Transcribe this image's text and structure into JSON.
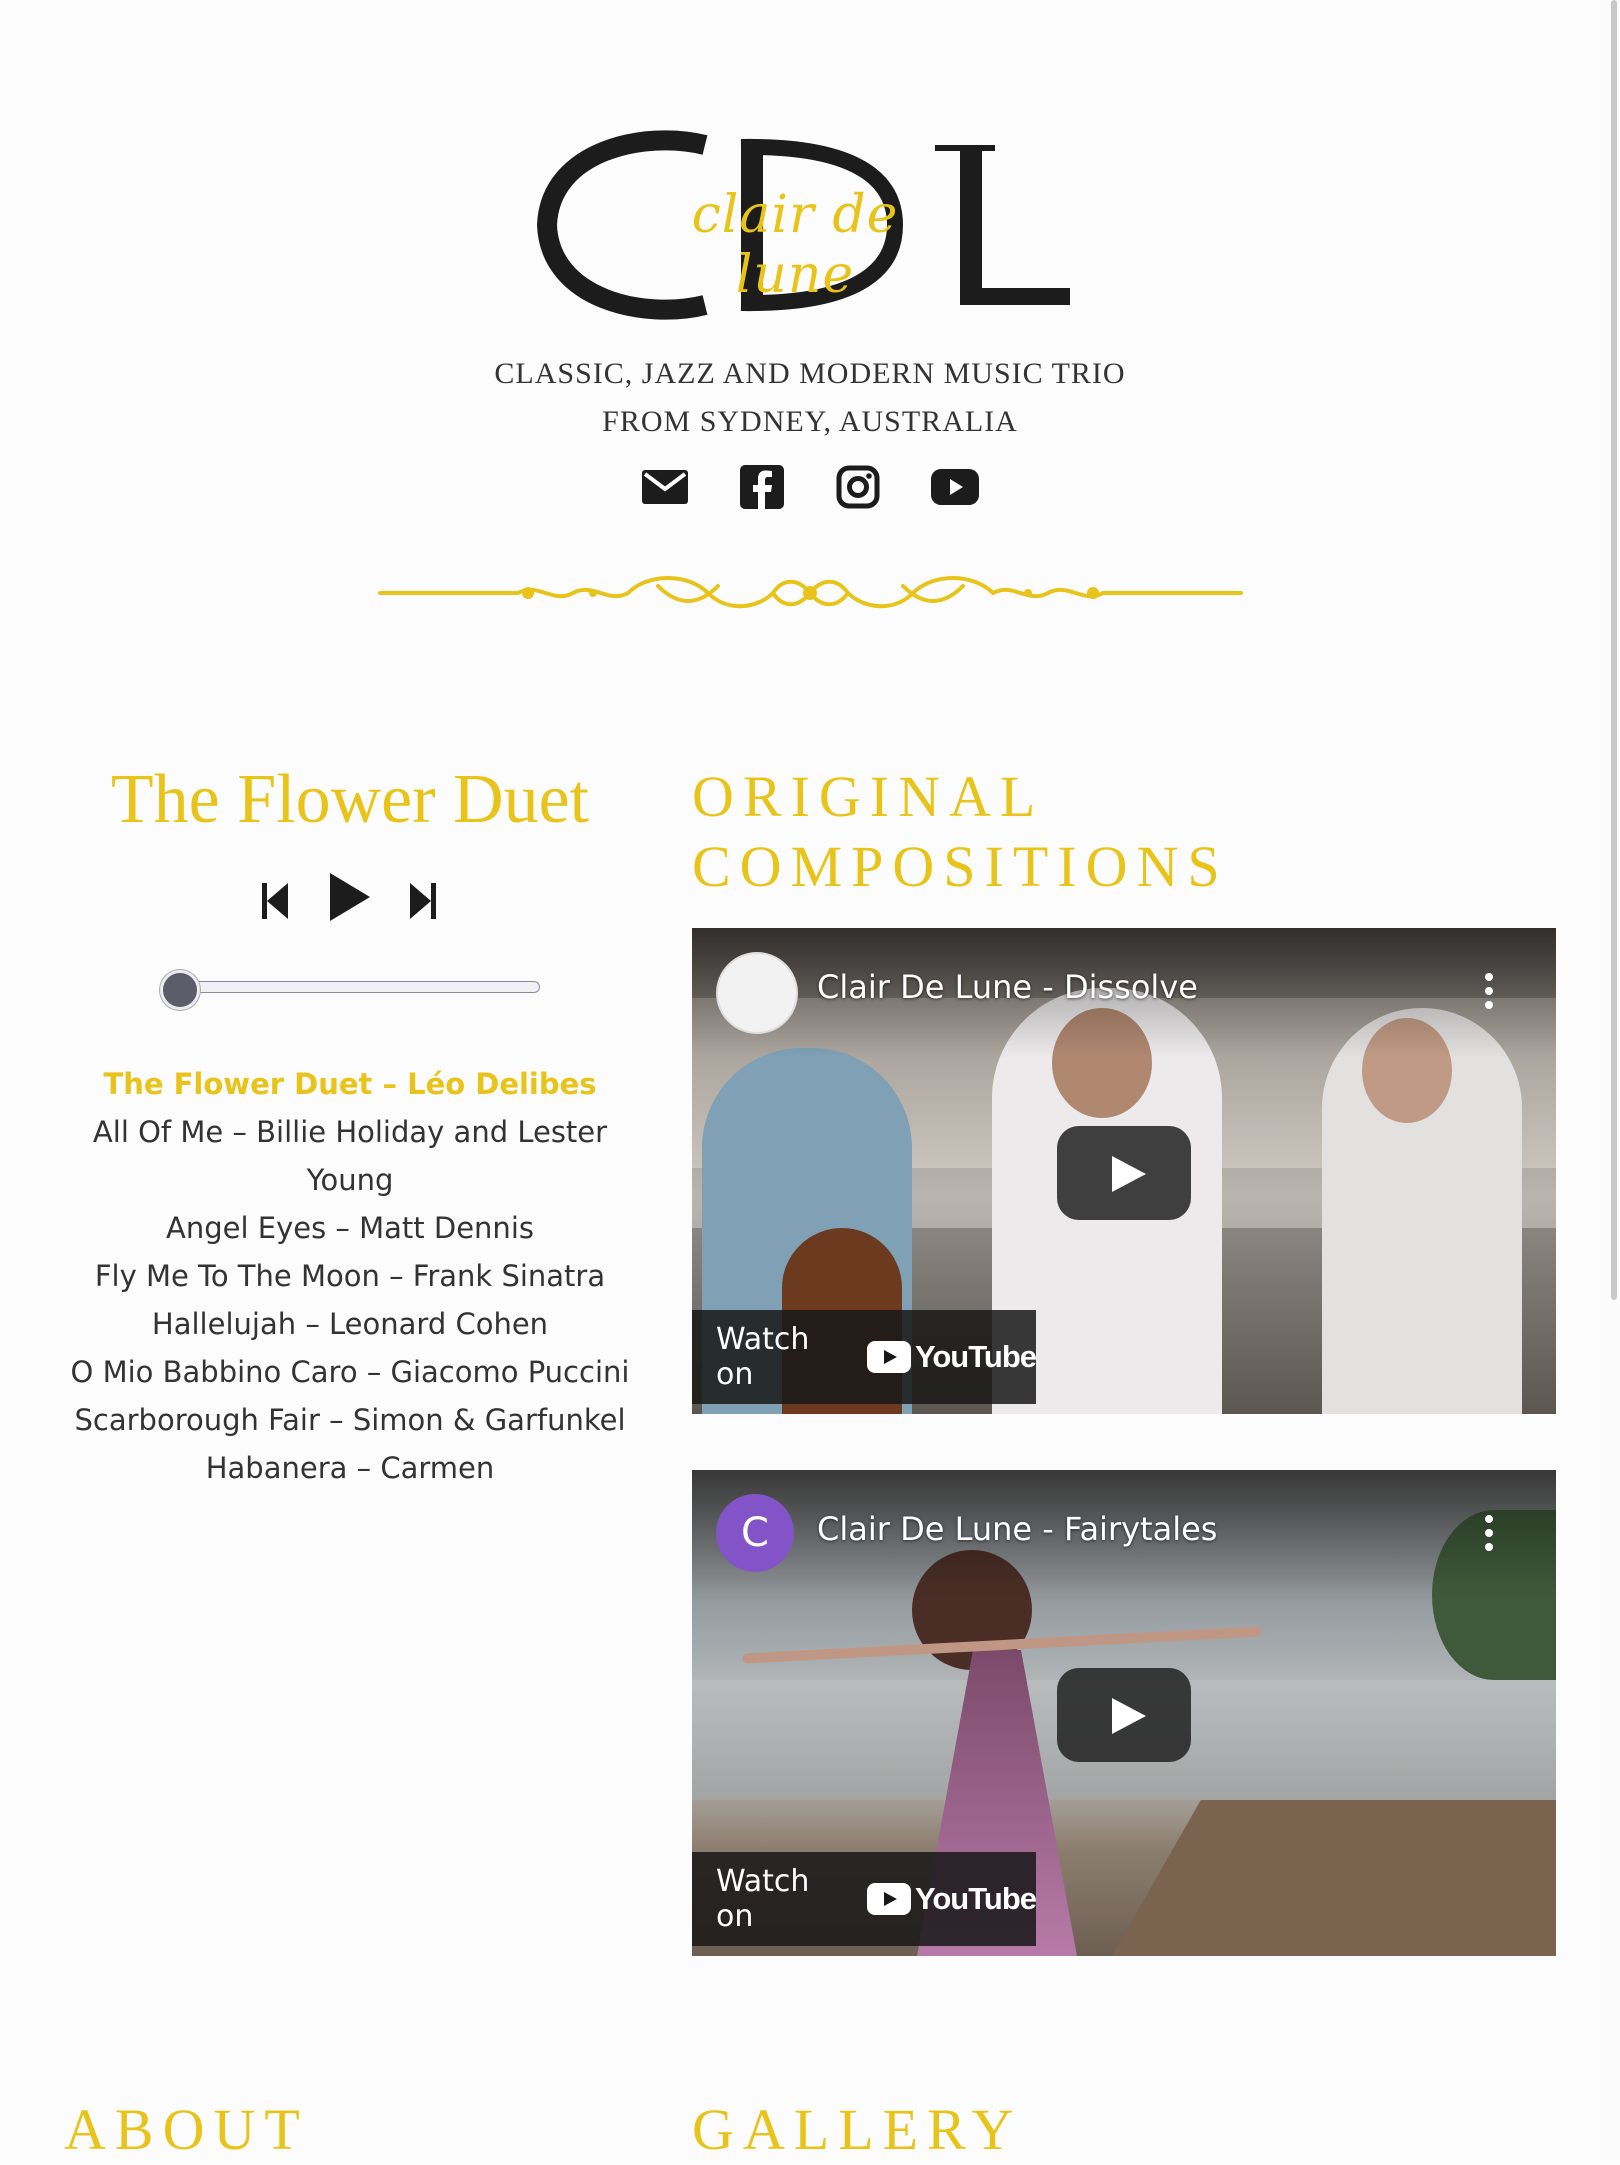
{
  "brand": {
    "monogram": "CDL",
    "script_name": "clair de lune",
    "tagline_line1": "CLASSIC, JAZZ AND MODERN MUSIC TRIO",
    "tagline_line2": "FROM SYDNEY, AUSTRALIA",
    "accent_color": "#e8c41a"
  },
  "social": [
    "mail-icon",
    "facebook-icon",
    "instagram-icon",
    "youtube-icon"
  ],
  "player": {
    "title": "The Flower Duet",
    "progress": 0,
    "playlist": [
      "The Flower Duet – Léo Delibes",
      "All Of Me – Billie Holiday and Lester Young",
      "Angel Eyes – Matt Dennis",
      "Fly Me To The Moon – Frank Sinatra",
      "Hallelujah – Leonard Cohen",
      "O Mio Babbino Caro – Giacomo Puccini",
      "Scarborough Fair – Simon & Garfunkel",
      "Habanera – Carmen"
    ],
    "active_index": 0
  },
  "sections": {
    "original_line1": "ORIGINAL",
    "original_line2": "COMPOSITIONS",
    "about": "ABOUT",
    "gallery": "GALLERY"
  },
  "videos": [
    {
      "title": "Clair De Lune - Dissolve",
      "watch_label": "Watch on",
      "youtube_label": "YouTube"
    },
    {
      "title": "Clair De Lune - Fairytales",
      "avatar_letter": "C",
      "watch_label": "Watch on",
      "youtube_label": "YouTube"
    }
  ]
}
